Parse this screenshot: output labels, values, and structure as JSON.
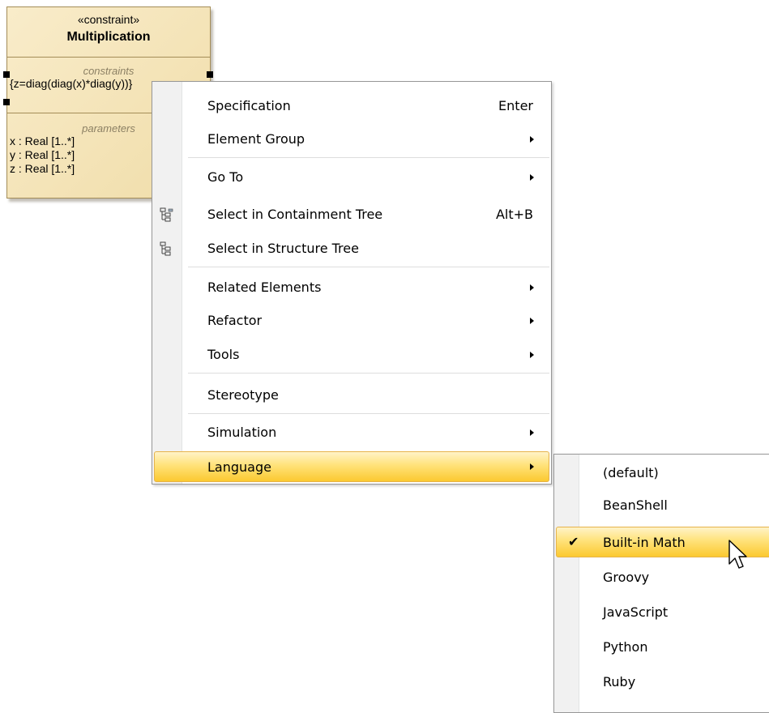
{
  "block": {
    "stereotype": "«constraint»",
    "name": "Multiplication",
    "constraints_title": "constraints",
    "constraint_text": "{z=diag(diag(x)*diag(y))}",
    "parameters_title": "parameters",
    "parameters": [
      "x : Real [1..*]",
      "y : Real [1..*]",
      "z : Real [1..*]"
    ]
  },
  "context_menu": {
    "items": [
      {
        "label": "Specification",
        "shortcut": "Enter"
      },
      {
        "label": "Element Group"
      },
      {
        "label": "Go To"
      },
      {
        "label": "Select in Containment Tree",
        "shortcut": "Alt+B",
        "icon": "containment-tree-icon"
      },
      {
        "label": "Select in Structure Tree",
        "icon": "structure-tree-icon"
      },
      {
        "label": "Related Elements"
      },
      {
        "label": "Refactor"
      },
      {
        "label": "Tools"
      },
      {
        "label": "Stereotype"
      },
      {
        "label": "Simulation"
      },
      {
        "label": "Language"
      }
    ]
  },
  "language_submenu": {
    "items": [
      {
        "label": "(default)"
      },
      {
        "label": "BeanShell"
      },
      {
        "label": "Built-in Math",
        "checked": true
      },
      {
        "label": "Groovy"
      },
      {
        "label": "JavaScript"
      },
      {
        "label": "Python"
      },
      {
        "label": "Ruby"
      }
    ],
    "check_glyph": "✔"
  },
  "colors": {
    "block_fill": "#f5e6bd",
    "block_border": "#a48d58",
    "highlight": "#ffd75a",
    "menu_border": "#979797"
  }
}
